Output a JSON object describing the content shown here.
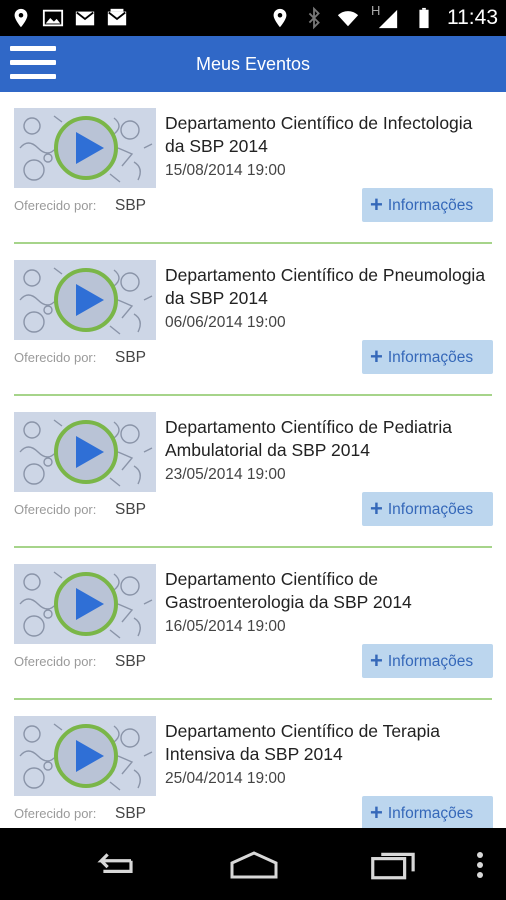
{
  "status_bar": {
    "time": "11:43",
    "network_label": "H",
    "left_icons": [
      "location-icon",
      "image-icon",
      "gmail-icon",
      "gmail-alt-icon"
    ],
    "right_icons": [
      "location-icon",
      "bluetooth-icon",
      "wifi-icon",
      "signal-icon",
      "battery-icon"
    ]
  },
  "app_bar": {
    "title": "Meus Eventos",
    "menu_icon": "hamburger-menu-icon",
    "color": "#3068c7"
  },
  "events": [
    {
      "title": "Departamento Científico de Infectologia da SBP 2014",
      "date": "15/08/2014 19:00",
      "offered_by_label": "Oferecido por:",
      "offered_by": "SBP",
      "info_button": "Informações"
    },
    {
      "title": "Departamento Científico de Pneumologia da SBP 2014",
      "date": "06/06/2014 19:00",
      "offered_by_label": "Oferecido por:",
      "offered_by": "SBP",
      "info_button": "Informações"
    },
    {
      "title": "Departamento Científico de Pediatria Ambulatorial da SBP 2014",
      "date": "23/05/2014 19:00",
      "offered_by_label": "Oferecido por:",
      "offered_by": "SBP",
      "info_button": "Informações"
    },
    {
      "title": "Departamento Científico de Gastroenterologia da SBP 2014",
      "date": "16/05/2014 19:00",
      "offered_by_label": "Oferecido por:",
      "offered_by": "SBP",
      "info_button": "Informações"
    },
    {
      "title": "Departamento Científico de Terapia Intensiva da SBP 2014",
      "date": "25/04/2014 19:00",
      "offered_by_label": "Oferecido por:",
      "offered_by": "SBP",
      "info_button": "Informações"
    }
  ],
  "colors": {
    "divider": "#a6d48a",
    "info_button_bg": "#bcd6ee",
    "info_button_text": "#3568b9",
    "play_ring": "#7ab648",
    "play_triangle": "#2f6fd6"
  },
  "nav_bar": {
    "icons": [
      "back-icon",
      "home-icon",
      "recent-apps-icon",
      "overflow-menu-icon"
    ]
  }
}
